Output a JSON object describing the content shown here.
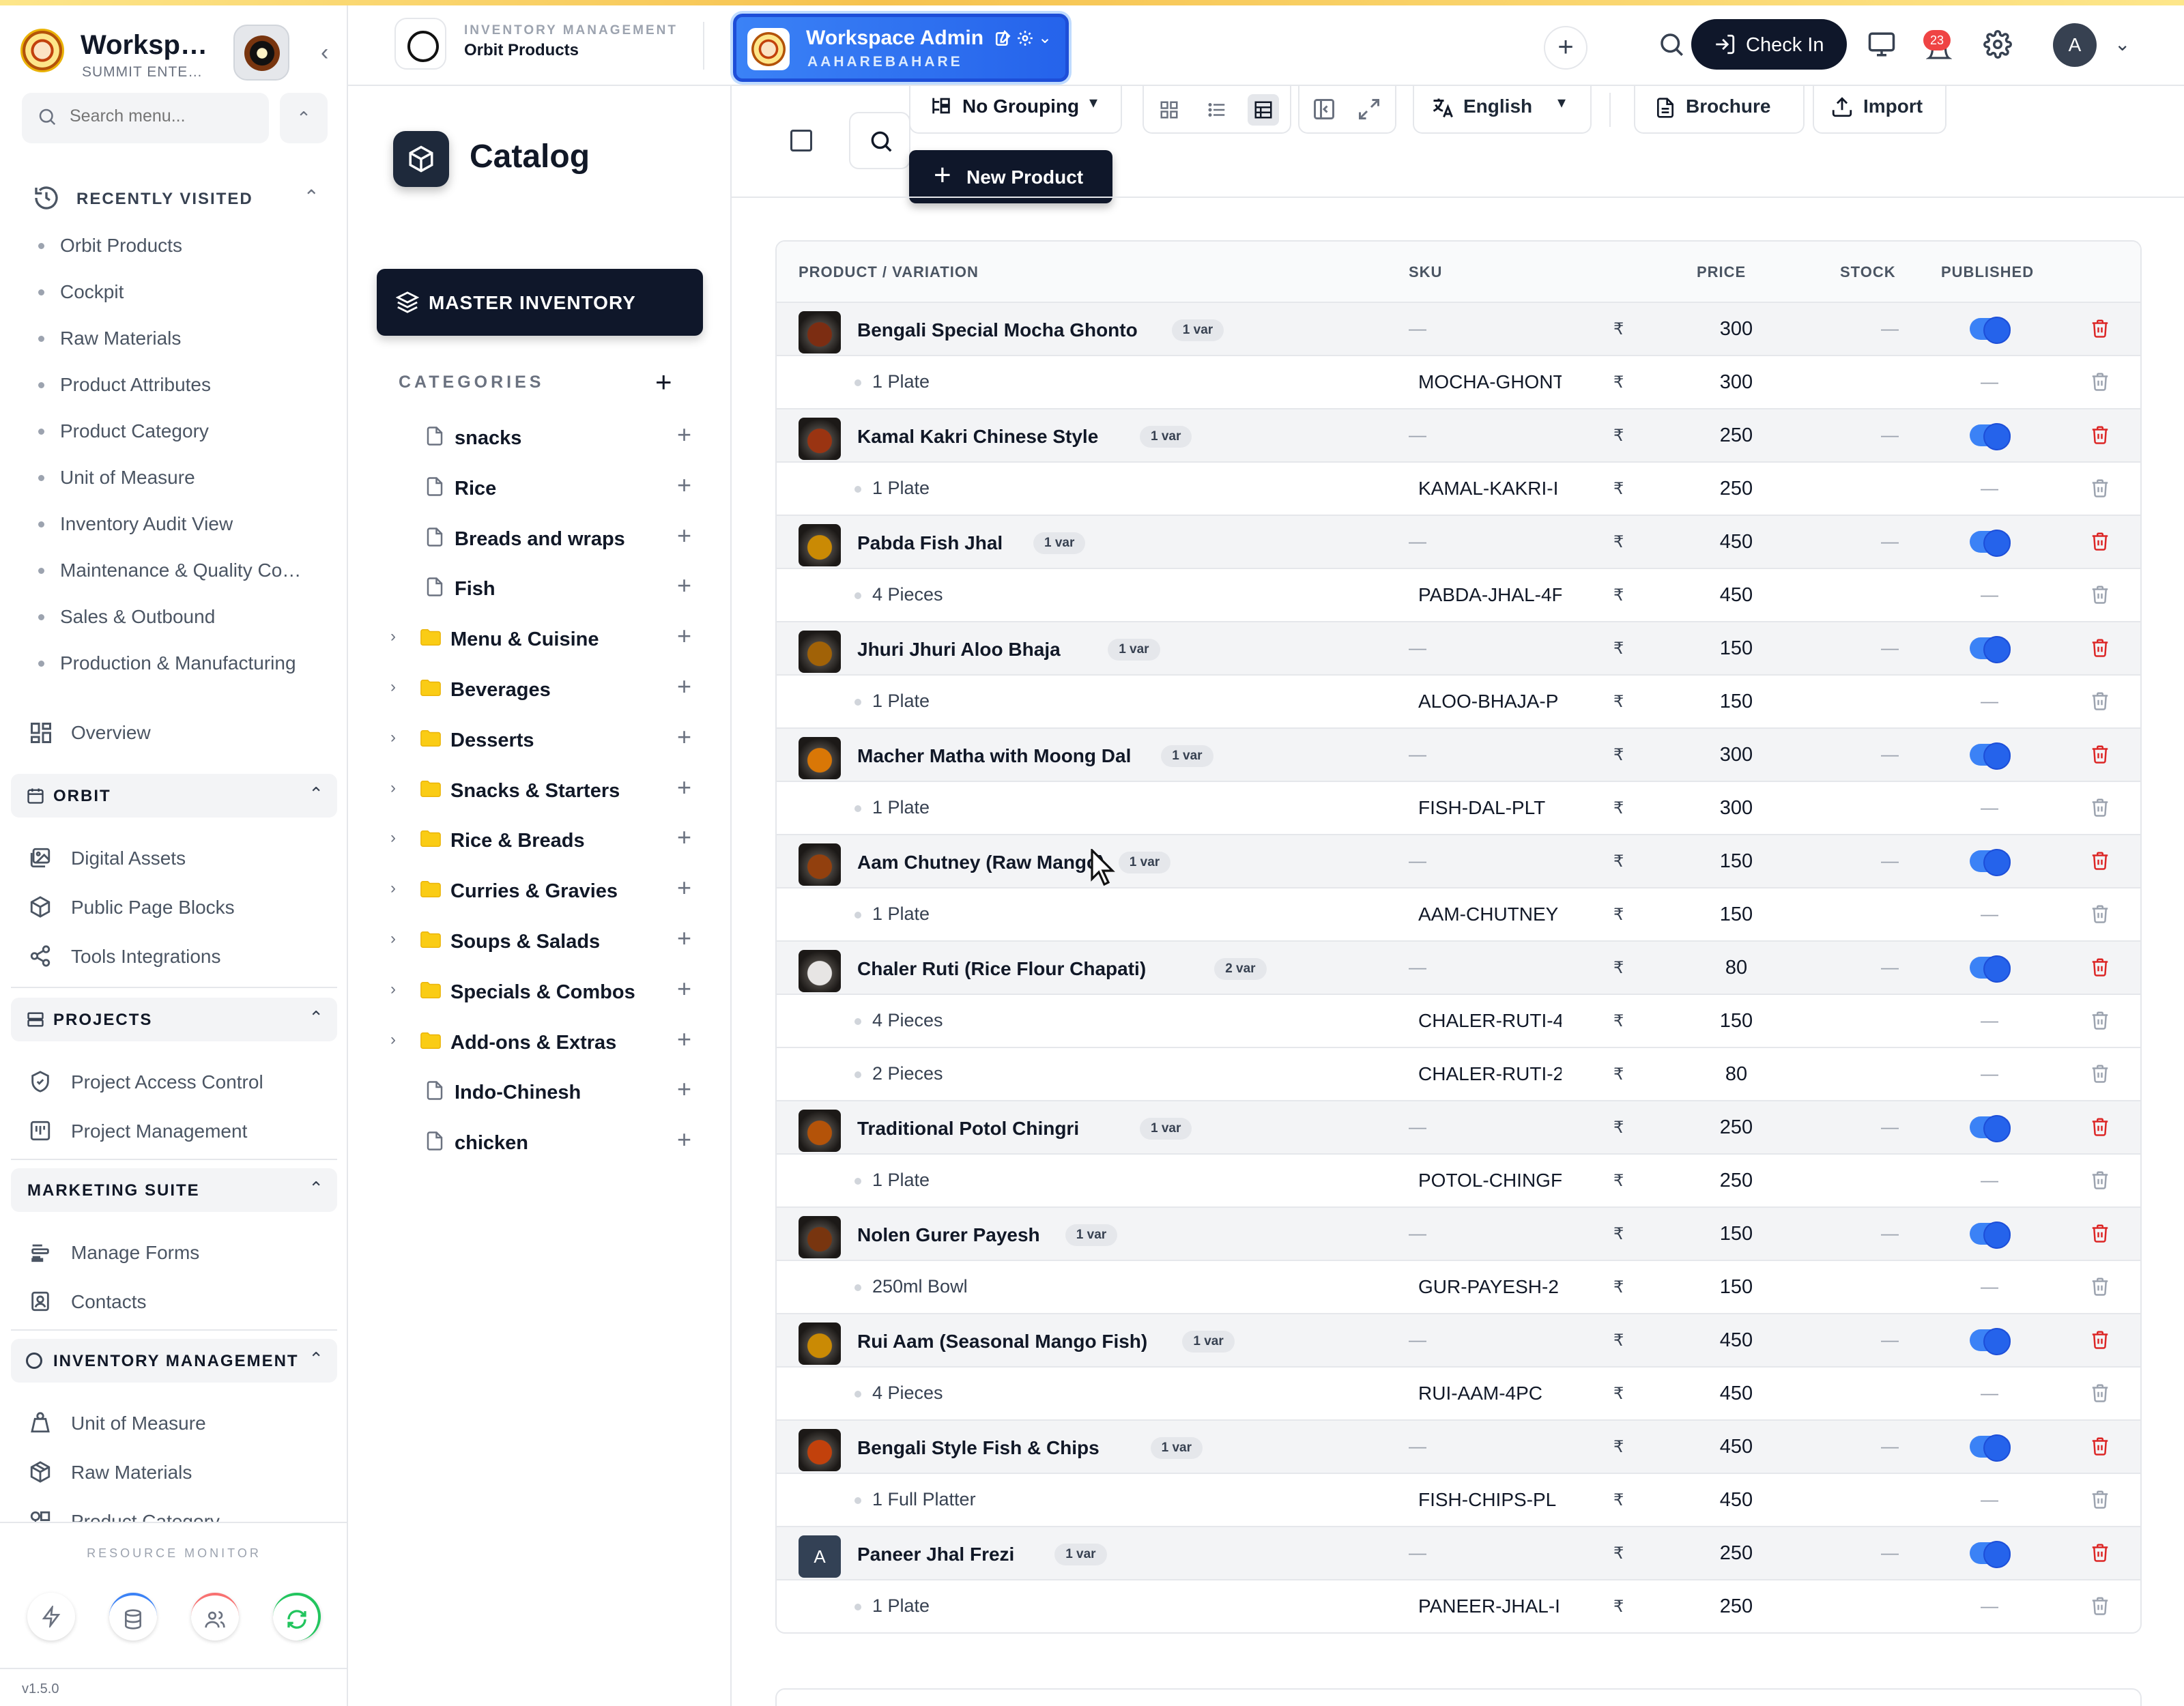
{
  "sidebar": {
    "workspace_name": "Worksp…",
    "workspace_sub": "SUMMIT ENTE…",
    "search_placeholder": "Search menu...",
    "recently_visited_label": "RECENTLY VISITED",
    "recent": [
      "Orbit Products",
      "Cockpit",
      "Raw Materials",
      "Product Attributes",
      "Product Category",
      "Unit of Measure",
      "Inventory Audit View",
      "Maintenance & Quality Co…",
      "Sales & Outbound",
      "Production & Manufacturing"
    ],
    "overview": "Overview",
    "orbit_label": "ORBIT",
    "orbit_items": [
      "Digital Assets",
      "Public Page Blocks",
      "Tools Integrations"
    ],
    "projects_label": "PROJECTS",
    "projects_items": [
      "Project Access Control",
      "Project Management"
    ],
    "marketing_label": "MARKETING SUITE",
    "marketing_items": [
      "Manage Forms",
      "Contacts"
    ],
    "inventory_label": "INVENTORY MANAGEMENT",
    "inventory_items": [
      "Unit of Measure",
      "Raw Materials",
      "Product Category"
    ],
    "resource_monitor": "RESOURCE MONITOR",
    "version": "v1.5.0"
  },
  "header": {
    "module_kicker": "INVENTORY MANAGEMENT",
    "module_title": "Orbit Products",
    "workspace_admin": "Workspace Admin",
    "workspace_code": "AAHAREBAHARE",
    "check_in": "Check In",
    "notifications": "23",
    "avatar_initial": "A"
  },
  "catalog": {
    "title": "Catalog",
    "master_inventory": "MASTER INVENTORY",
    "categories_label": "CATEGORIES",
    "tree": [
      {
        "label": "snacks",
        "type": "file"
      },
      {
        "label": "Rice",
        "type": "file"
      },
      {
        "label": "Breads and wraps",
        "type": "file"
      },
      {
        "label": "Fish",
        "type": "file"
      },
      {
        "label": "Menu & Cuisine",
        "type": "folder"
      },
      {
        "label": "Beverages",
        "type": "folder"
      },
      {
        "label": "Desserts",
        "type": "folder"
      },
      {
        "label": "Snacks & Starters",
        "type": "folder"
      },
      {
        "label": "Rice & Breads",
        "type": "folder"
      },
      {
        "label": "Curries & Gravies",
        "type": "folder"
      },
      {
        "label": "Soups & Salads",
        "type": "folder"
      },
      {
        "label": "Specials & Combos",
        "type": "folder"
      },
      {
        "label": "Add-ons & Extras",
        "type": "folder"
      },
      {
        "label": "Indo-Chinesh",
        "type": "file"
      },
      {
        "label": "chicken",
        "type": "file"
      }
    ]
  },
  "toolbar": {
    "grouping": "No Grouping",
    "language": "English",
    "brochure": "Brochure",
    "import": "Import",
    "new_product": "New Product"
  },
  "table": {
    "headers": {
      "product": "PRODUCT / VARIATION",
      "sku": "SKU",
      "price": "PRICE",
      "stock": "STOCK",
      "published": "PUBLISHED"
    },
    "currency": "₹",
    "dash": "—",
    "products": [
      {
        "name": "Bengali Special Mocha Ghonto",
        "badge": "1 var",
        "price": "300",
        "thumb": "#7c2d12",
        "variants": [
          {
            "name": "1 Plate",
            "sku": "MOCHA-GHONT",
            "price": "300"
          }
        ]
      },
      {
        "name": "Kamal Kakri Chinese Style",
        "badge": "1 var",
        "price": "250",
        "thumb": "#9a3412",
        "variants": [
          {
            "name": "1 Plate",
            "sku": "KAMAL-KAKRI-I",
            "price": "250"
          }
        ]
      },
      {
        "name": "Pabda Fish Jhal",
        "badge": "1 var",
        "price": "450",
        "thumb": "#ca8a04",
        "variants": [
          {
            "name": "4 Pieces",
            "sku": "PABDA-JHAL-4F",
            "price": "450"
          }
        ]
      },
      {
        "name": "Jhuri Jhuri Aloo Bhaja",
        "badge": "1 var",
        "price": "150",
        "thumb": "#a16207",
        "variants": [
          {
            "name": "1 Plate",
            "sku": "ALOO-BHAJA-P",
            "price": "150"
          }
        ]
      },
      {
        "name": "Macher Matha with Moong Dal",
        "badge": "1 var",
        "price": "300",
        "thumb": "#d97706",
        "variants": [
          {
            "name": "1 Plate",
            "sku": "FISH-DAL-PLT",
            "price": "300"
          }
        ]
      },
      {
        "name": "Aam Chutney (Raw Mango)",
        "badge": "1 var",
        "price": "150",
        "thumb": "#92400e",
        "variants": [
          {
            "name": "1 Plate",
            "sku": "AAM-CHUTNEY",
            "price": "150"
          }
        ]
      },
      {
        "name": "Chaler Ruti (Rice Flour Chapati)",
        "badge": "2 var",
        "price": "80",
        "thumb": "#e7e5e4",
        "variants": [
          {
            "name": "4 Pieces",
            "sku": "CHALER-RUTI-4",
            "price": "150"
          },
          {
            "name": "2 Pieces",
            "sku": "CHALER-RUTI-2",
            "price": "80"
          }
        ]
      },
      {
        "name": "Traditional Potol Chingri",
        "badge": "1 var",
        "price": "250",
        "thumb": "#b45309",
        "variants": [
          {
            "name": "1 Plate",
            "sku": "POTOL-CHINGF",
            "price": "250"
          }
        ]
      },
      {
        "name": "Nolen Gurer Payesh",
        "badge": "1 var",
        "price": "150",
        "thumb": "#78350f",
        "variants": [
          {
            "name": "250ml Bowl",
            "sku": "GUR-PAYESH-2",
            "price": "150"
          }
        ]
      },
      {
        "name": "Rui Aam (Seasonal Mango Fish)",
        "badge": "1 var",
        "price": "450",
        "thumb": "#ca8a04",
        "variants": [
          {
            "name": "4 Pieces",
            "sku": "RUI-AAM-4PC",
            "price": "450"
          }
        ]
      },
      {
        "name": "Bengali Style Fish & Chips",
        "badge": "1 var",
        "price": "450",
        "thumb": "#c2410c",
        "variants": [
          {
            "name": "1 Full Platter",
            "sku": "FISH-CHIPS-PL",
            "price": "450"
          }
        ]
      },
      {
        "name": "Paneer Jhal Frezi",
        "badge": "1 var",
        "price": "250",
        "thumb": "#334155",
        "thumb_letter": "A",
        "variants": [
          {
            "name": "1 Plate",
            "sku": "PANEER-JHAL-I",
            "price": "250"
          }
        ]
      }
    ]
  }
}
